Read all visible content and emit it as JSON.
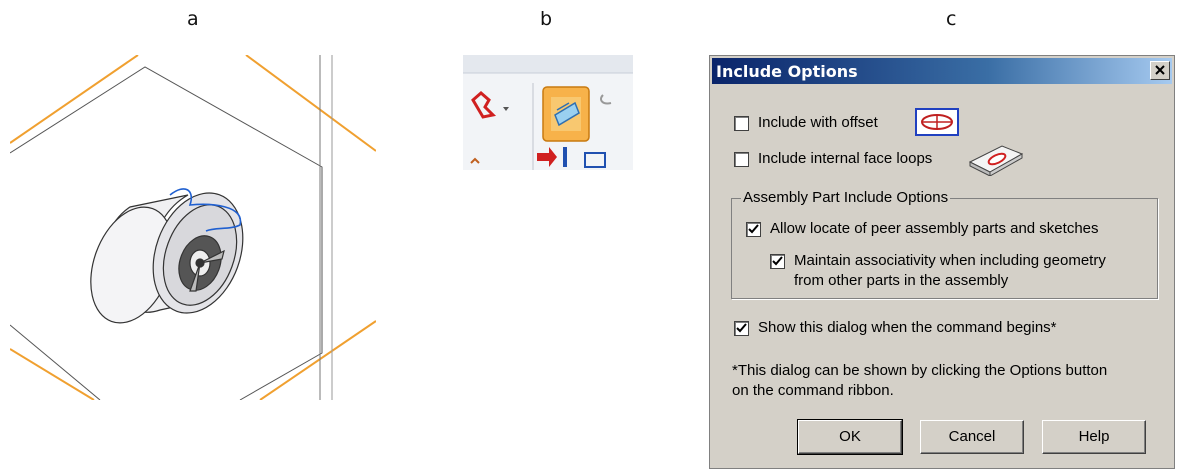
{
  "panel_labels": {
    "a": "a",
    "b": "b",
    "c": "c"
  },
  "dialog": {
    "title": "Include Options",
    "close_glyph": "×",
    "options": {
      "include_with_offset": {
        "label": "Include with offset",
        "checked": false,
        "icon": "offset-icon"
      },
      "include_internal_face_loops": {
        "label": "Include internal face loops",
        "checked": false,
        "icon": "face-loop-icon"
      }
    },
    "assembly_group": {
      "title": "Assembly Part Include Options",
      "allow_locate": {
        "label": "Allow locate of peer assembly parts and sketches",
        "checked": true
      },
      "maintain_assoc": {
        "line1": "Maintain associativity when including geometry",
        "line2": "from other parts in the assembly",
        "checked": true
      }
    },
    "show_dialog": {
      "label": "Show this dialog when the command begins*",
      "checked": true
    },
    "note": {
      "line1": "*This dialog can be shown by clicking the Options button",
      "line2": "on the command ribbon."
    },
    "buttons": {
      "ok": "OK",
      "cancel": "Cancel",
      "help": "Help"
    }
  },
  "colors": {
    "accent_orange": "#f0a030",
    "highlight_blue": "#2060d0",
    "dialog_bg": "#d4d0c8",
    "title_bar": "#0a246a"
  }
}
